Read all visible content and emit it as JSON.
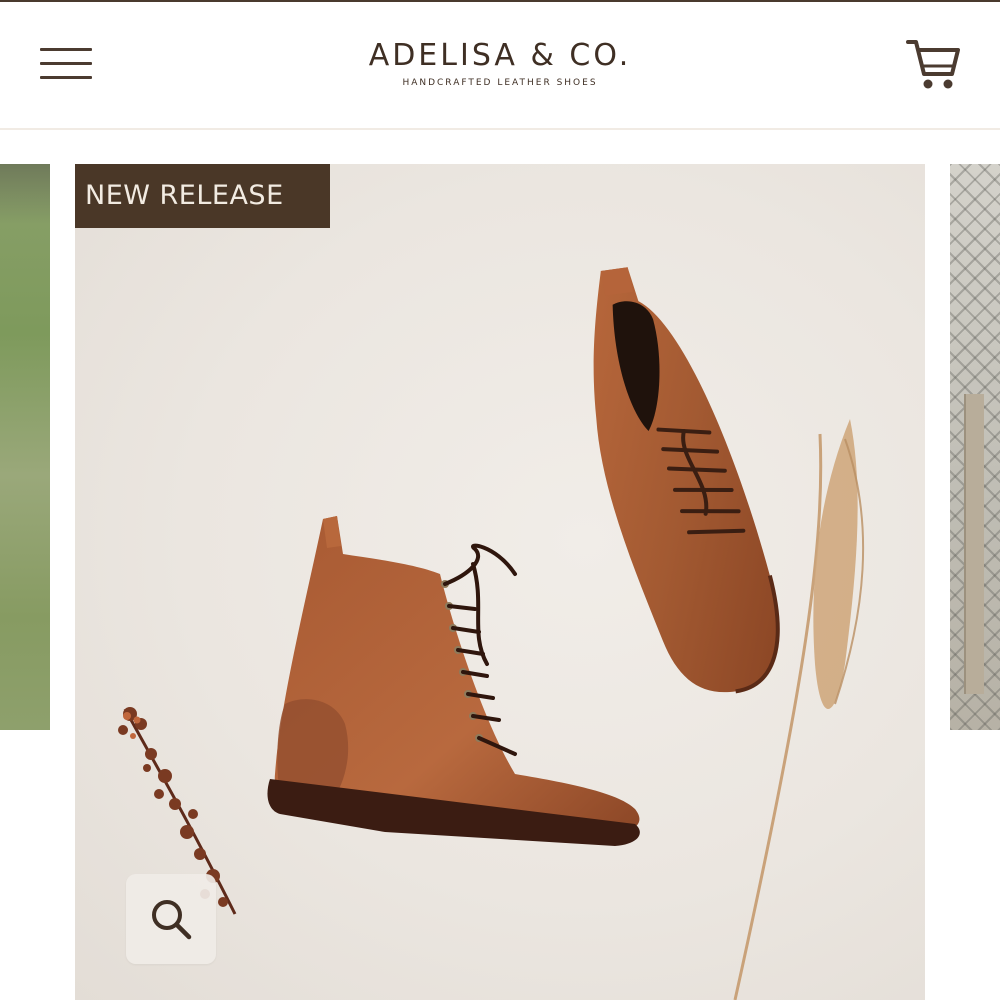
{
  "header": {
    "brand_name": "ADELISA & CO.",
    "tagline": "HANDCRAFTED LEATHER SHOES",
    "menu_icon": "hamburger-menu-icon",
    "cart_icon": "shopping-cart-icon"
  },
  "carousel": {
    "current_slide": {
      "badge": "NEW RELEASE",
      "product": "lace-up leather boots"
    },
    "zoom_icon": "magnifier-icon"
  },
  "colors": {
    "brand_dark": "#3f2f24",
    "badge_bg": "#4a3727",
    "badge_text": "#f2ebe2",
    "boot_leather": "#a0552e",
    "hero_bg": "#ebe6e0"
  }
}
